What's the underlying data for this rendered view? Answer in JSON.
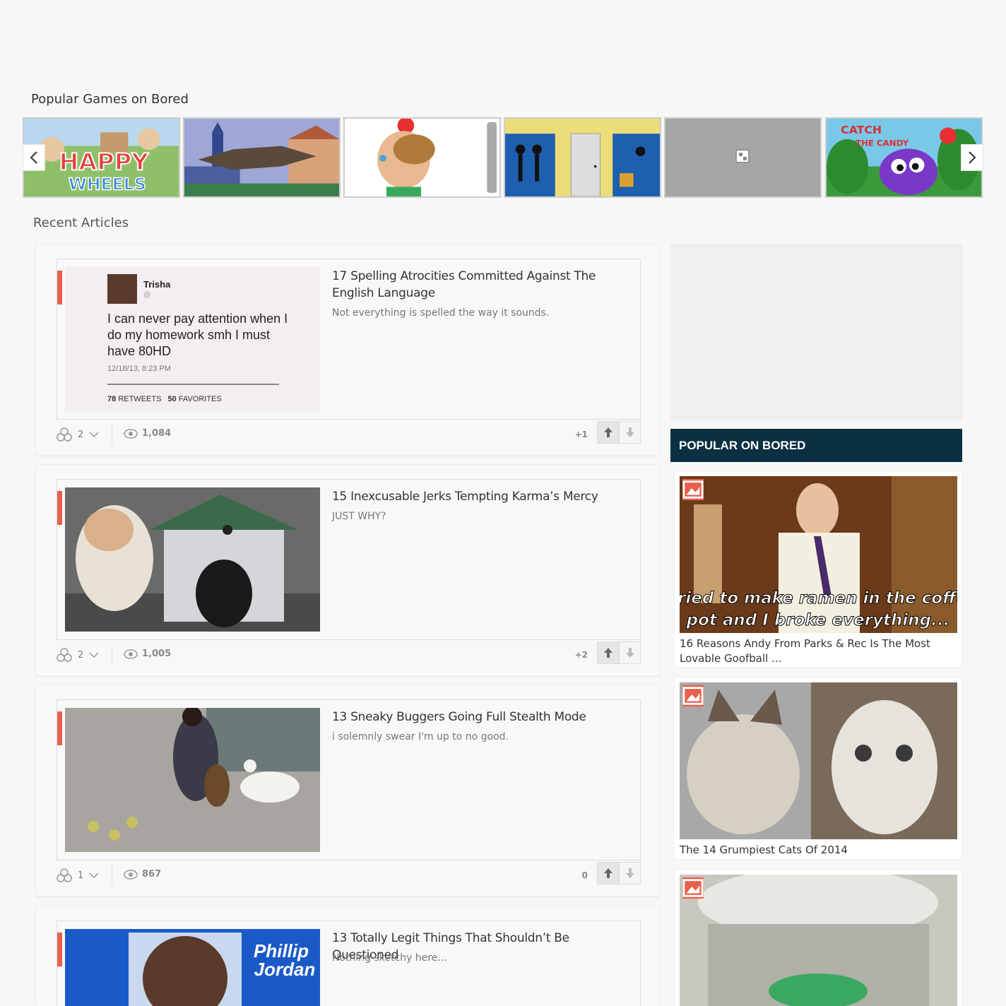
{
  "games": {
    "title": "Popular Games on Bored",
    "items": [
      {
        "name": "Happy Wheels",
        "logo_line1": "HAPPY",
        "logo_line2": "WHEELS"
      },
      {
        "name": "Dinosaur City"
      },
      {
        "name": "Apple Head"
      },
      {
        "name": "Stick Office"
      },
      {
        "name": "Placeholder"
      },
      {
        "name": "Catch the Candy",
        "logo_line1": "CATCH",
        "logo_line2": "THE CANDY"
      }
    ],
    "prev_icon": "chevron-left-icon",
    "next_icon": "chevron-right-icon"
  },
  "recent": {
    "title": "Recent Articles",
    "articles": [
      {
        "title": "17 Spelling Atrocities Committed Against The English Language",
        "subtitle": "Not everything is spelled the way it sounds.",
        "shares": "2",
        "views": "1,084",
        "score": "+1",
        "thumb": {
          "name": "Trisha",
          "tweet_line1": "I can never pay attention when I",
          "tweet_line2": "do my homework smh I must",
          "tweet_line3": "have 80HD",
          "date": "12/18/13, 8:23 PM",
          "retweets_num": "78",
          "retweets_label": "RETWEETS",
          "favorites_num": "50",
          "favorites_label": "FAVORITES"
        }
      },
      {
        "title": "15 Inexcusable Jerks Tempting Karma’s Mercy",
        "subtitle": "JUST WHY?",
        "shares": "2",
        "views": "1,005",
        "score": "+2"
      },
      {
        "title": "13 Sneaky Buggers Going Full Stealth Mode",
        "subtitle": "i solemnly swear I'm up to no good.",
        "shares": "1",
        "views": "867",
        "score": "0"
      },
      {
        "title": "13 Totally Legit Things That Shouldn’t Be Questioned",
        "subtitle": "Nothing sketchy here...",
        "thumb": {
          "name_line1": "Phillip",
          "name_line2": "Jordan"
        }
      }
    ]
  },
  "sidebar": {
    "popular_title": "POPULAR ON BORED",
    "items": [
      {
        "title": "16 Reasons Andy From Parks & Rec Is The Most Lovable Goofball ...",
        "caption_line1": "I tried to make ramen in the coffee",
        "caption_line2": "pot and I broke everything..."
      },
      {
        "title": "The 14 Grumpiest Cats Of 2014"
      },
      {
        "title": ""
      }
    ]
  },
  "colors": {
    "accent": "#e8604c",
    "header_bg": "#0b3042",
    "background": "#f7f7f7"
  }
}
